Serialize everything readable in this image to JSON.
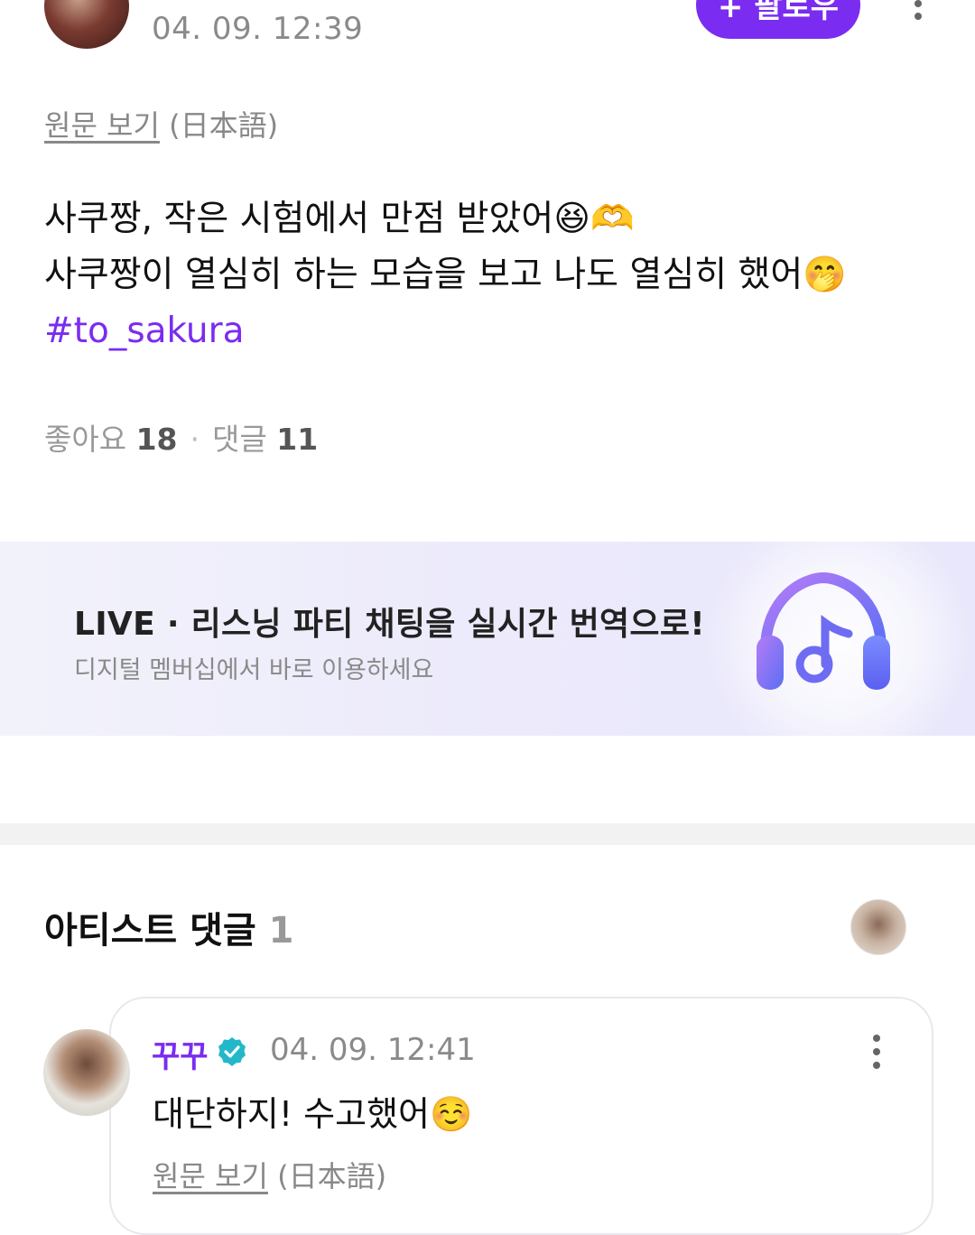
{
  "post": {
    "timestamp": "04. 09. 12:39",
    "follow_label": "+ 팔로우",
    "original_link": "원문 보기",
    "original_lang": "(日本語)",
    "body_line1": "사쿠짱, 작은 시험에서 만점 받았어😆🫶",
    "body_line2": "사쿠짱이 열심히 하는 모습을 보고 나도 열심히 했어🤭",
    "hashtag": "#to_sakura",
    "likes_label": "좋아요",
    "likes_count": "18",
    "comments_label": "댓글",
    "comments_count": "11"
  },
  "banner": {
    "title": "LIVE · 리스닝 파티 채팅을 실시간 번역으로!",
    "subtitle": "디지털 멤버십에서 바로 이용하세요",
    "icon": "headphones-music-icon"
  },
  "artist_comments": {
    "title": "아티스트 댓글",
    "count": "1",
    "items": [
      {
        "name": "꾸꾸",
        "verified": true,
        "timestamp": "04. 09. 12:41",
        "text": "대단하지! 수고했어☺️",
        "original_link": "원문 보기",
        "original_lang": "(日本語)"
      }
    ]
  },
  "colors": {
    "accent": "#7a2cf0",
    "verified": "#22b8c9",
    "muted": "#8a8a8a"
  }
}
